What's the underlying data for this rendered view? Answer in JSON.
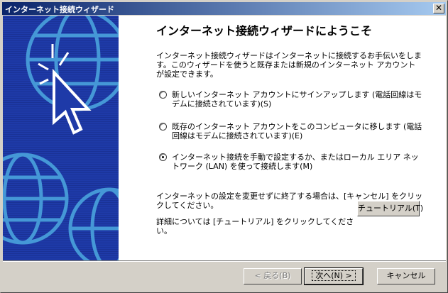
{
  "window": {
    "title": "インターネット接続ウィザード",
    "close_glyph": "✕"
  },
  "main": {
    "heading": "インターネット接続ウィザードにようこそ",
    "intro": "インターネット接続ウィザードはインターネットに接続するお手伝いをします。このウィザードを使うと既存または新規のインターネット アカウントが設定できます。",
    "options": [
      {
        "label": "新しいインターネット アカウントにサインアップします (電話回線はモデムに接続されています)(S)",
        "checked": false
      },
      {
        "label": "既存のインターネット アカウントをこのコンピュータに移します (電話回線はモデムに接続されています)(E)",
        "checked": false
      },
      {
        "label": "インターネット接続を手動で設定するか、またはローカル エリア ネットワーク (LAN) を使って接続します(M)",
        "checked": true
      }
    ],
    "cancel_note": "インターネットの設定を変更せずに終了する場合は、[キャンセル] をクリックしてください。",
    "tutorial_note": "詳細については [チュートリアル] をクリックしてください。",
    "tutorial_button": "チュートリアル(T)"
  },
  "footer": {
    "back_button": "< 戻る(B)",
    "next_button": "次へ(N) >",
    "cancel_button": "キャンセル"
  },
  "colors": {
    "title_start": "#0a246a",
    "title_end": "#a6caf0",
    "side_panel": "#1e3aa8",
    "face": "#d4d0c8"
  },
  "icons": [
    "close-icon",
    "cursor-click-icon",
    "globe-icon"
  ]
}
